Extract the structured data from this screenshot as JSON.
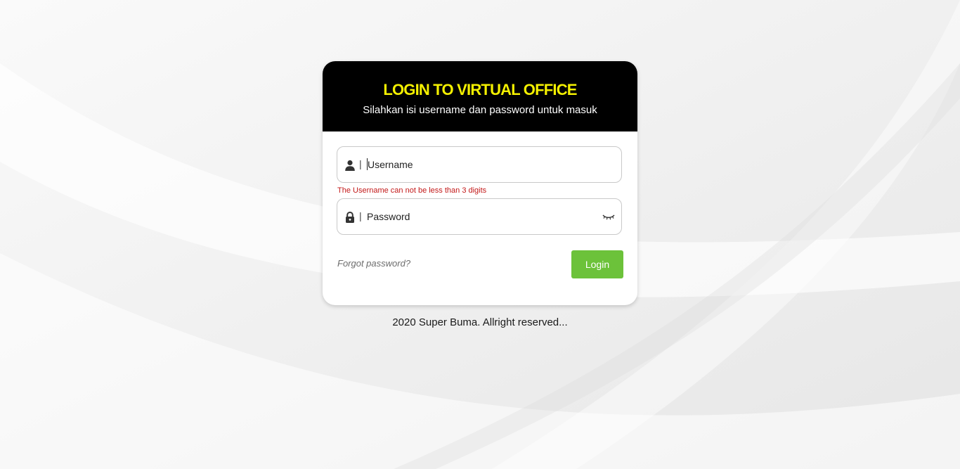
{
  "colors": {
    "title": "#f4f000",
    "header_bg": "#000000",
    "login_button": "#6cc23a",
    "error_text": "#c31919"
  },
  "header": {
    "title": "LOGIN TO VIRTUAL OFFICE",
    "subtitle": "Silahkan isi username dan password untuk masuk"
  },
  "username": {
    "icon": "user-icon",
    "separator": "|",
    "placeholder": "Username",
    "error": "The Username can not be less than 3 digits"
  },
  "password": {
    "icon": "lock-icon",
    "separator": "|",
    "placeholder": "Password",
    "toggle_icon": "eye-closed-icon"
  },
  "actions": {
    "forgot": "Forgot password?",
    "login": "Login"
  },
  "footer": {
    "text": "2020 Super Buma. Allright reserved..."
  }
}
